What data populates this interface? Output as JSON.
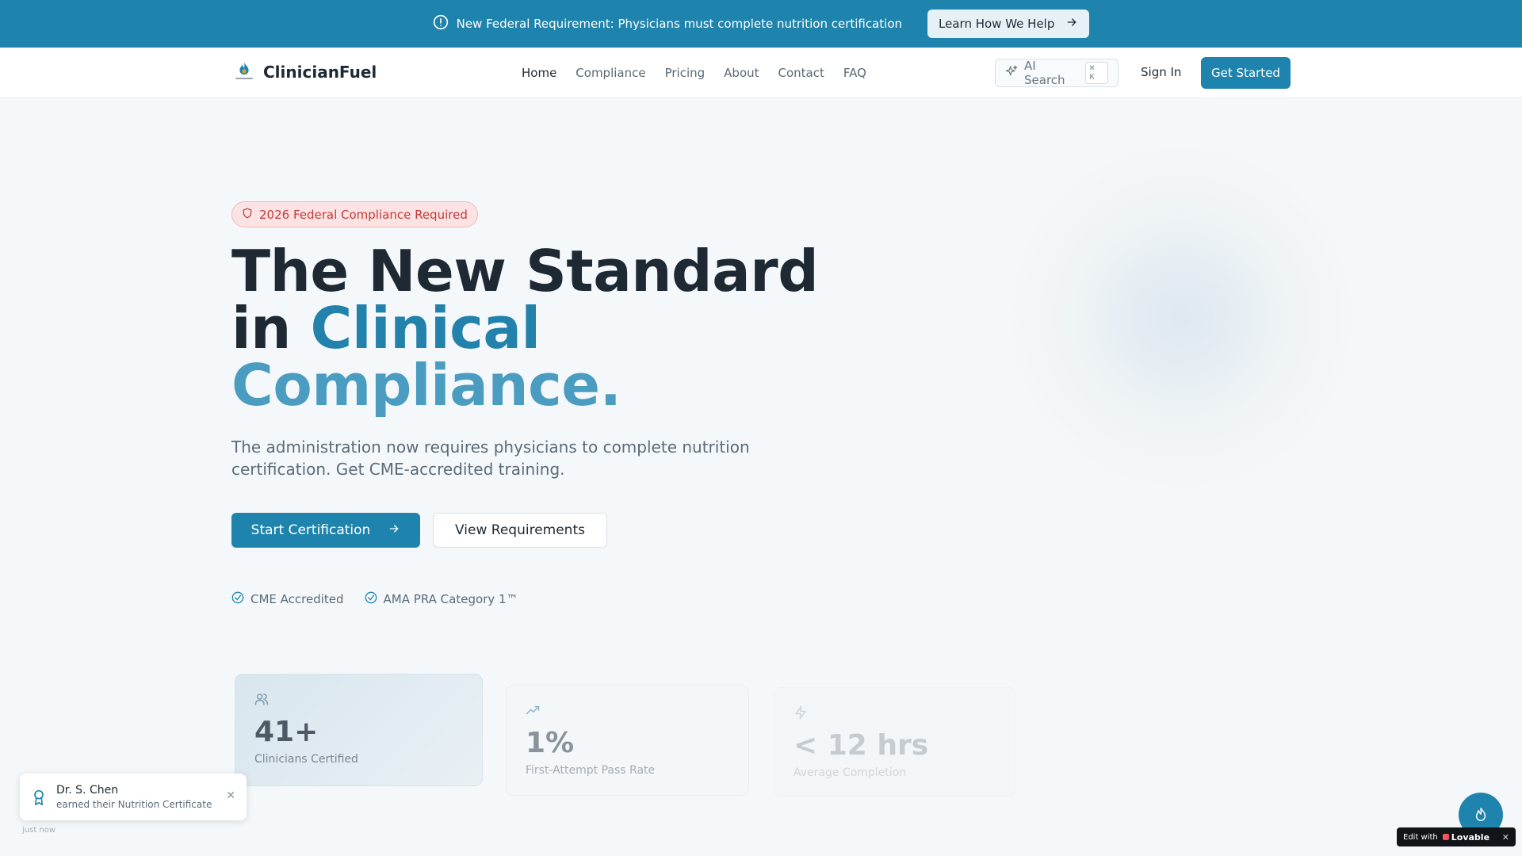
{
  "banner": {
    "message": "New Federal Requirement: Physicians must complete nutrition certification",
    "cta_label": "Learn How We Help"
  },
  "nav": {
    "brand": "ClinicianFuel",
    "links": [
      {
        "label": "Home",
        "active": true
      },
      {
        "label": "Compliance",
        "active": false
      },
      {
        "label": "Pricing",
        "active": false
      },
      {
        "label": "About",
        "active": false
      },
      {
        "label": "Contact",
        "active": false
      },
      {
        "label": "FAQ",
        "active": false
      }
    ],
    "search_label": "AI Search",
    "search_shortcut": "⌘ K",
    "signin_label": "Sign In",
    "get_started_label": "Get Started"
  },
  "hero": {
    "badge": "2026 Federal Compliance Required",
    "title_line1": "The New Standard",
    "title_line2_prefix": "in ",
    "title_line2_accent": "Clinical",
    "title_line3_accent": "Compliance.",
    "subtitle": "The administration now requires physicians to complete nutrition certification. Get CME-accredited training.",
    "primary_cta": "Start Certification",
    "secondary_cta": "View Requirements",
    "checks": [
      "CME Accredited",
      "AMA PRA Category 1™"
    ]
  },
  "stats": [
    {
      "value": "41+",
      "label": "Clinicians Certified",
      "icon": "users-icon"
    },
    {
      "value": "1%",
      "label": "First-Attempt Pass Rate",
      "icon": "trending-up-icon"
    },
    {
      "value": "< 12 hrs",
      "label": "Average Completion",
      "icon": "zap-icon"
    }
  ],
  "toast": {
    "name": "Dr. S. Chen",
    "message": "earned their Nutrition Certificate",
    "time": "just now"
  },
  "lovable": {
    "prefix": "Edit with",
    "brand": "Lovable"
  },
  "colors": {
    "primary": "#1f84ad",
    "badge_red": "#c63a3a",
    "accent_light": "#4a9cc0"
  }
}
